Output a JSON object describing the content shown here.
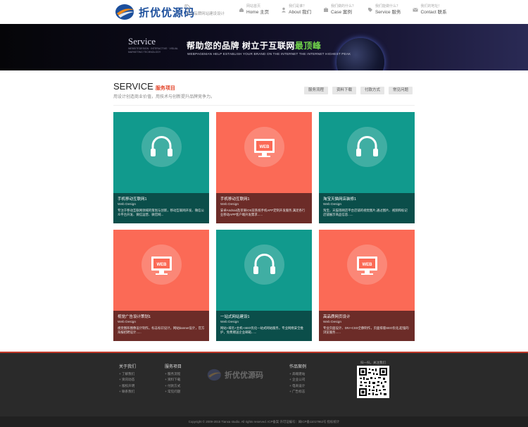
{
  "header": {
    "logo_text": "折优优源码",
    "tagline": "专注品牌网站建设设计",
    "nav": [
      {
        "sub": "网站首页",
        "label": "Home 主页",
        "icon": "home-icon"
      },
      {
        "sub": "我们是谁？",
        "label": "About 我们",
        "icon": "user-icon"
      },
      {
        "sub": "我们做的什么？",
        "label": "Case 案例",
        "icon": "case-icon"
      },
      {
        "sub": "我们能做什么？",
        "label": "Service 服务",
        "icon": "service-icon"
      },
      {
        "sub": "我们的地址！",
        "label": "Contact 联系",
        "icon": "mail-icon"
      }
    ]
  },
  "banner": {
    "service_word": "Service",
    "service_small": "WEBSITEDESIGN · INTERACTIVE · VISUAL MARKETING TECHNOLOGY",
    "headline_main": "帮助您的品牌  树立于互联网",
    "headline_accent": "最顶峰",
    "subline": "WEBPAGEMAN HELP ESTABLISH YOUR BRAND ON THE INTERNET THE INTERNET HIGHEST PEAK"
  },
  "section": {
    "title_en": "SERVICE",
    "title_cn": "服务项目",
    "description": "用设计创造商业价值，用技术与创新提升品牌竞争力。",
    "tabs": [
      "服务流程",
      "资料下载",
      "付款方式",
      "常见问题"
    ]
  },
  "cards": [
    {
      "theme": "teal",
      "icon": "headphones-icon",
      "title": "手机移动互联网1",
      "en": "Web Design",
      "desc": "专注于移动互联网领域的策划与创新，移动互联网开发、微信公众平台开发、微信运营、微官网..."
    },
    {
      "theme": "coral",
      "icon": "web-monitor-icon",
      "icon_label": "WEB",
      "title": "手机移动互联网1",
      "en": "Web Design",
      "desc": "安卓Android及苹果iOS双系统手机APP定制开发服务,满足各行业移动APP客户端开发需求......"
    },
    {
      "theme": "teal",
      "icon": "headphones-icon",
      "title": "淘宝天猫网店装修1",
      "en": "Web Design",
      "desc": "淘宝、天猫等网店平台店铺的视觉图片,通过图片、视频和标记店铺展示商品信息......"
    },
    {
      "theme": "coral",
      "icon": "web-monitor-icon",
      "icon_label": "WEB",
      "title": "视觉广告设计策划1",
      "en": "Web Design",
      "desc": "视觉图形图像设计制作，标志标识设计，网站banner设计，官方海报招聘设计......"
    },
    {
      "theme": "teal",
      "icon": "headphones-icon",
      "title": "一站式网站建设1",
      "en": "Web Design",
      "desc": "网站+域名+主机+SEO优化一站式网站服务，专业网络安全维护，免费赠送企业邮箱......"
    },
    {
      "theme": "coral",
      "icon": "web-monitor-icon",
      "icon_label": "WEB",
      "title": "高品质网页设计",
      "en": "Web Design",
      "desc": "专业页面设计、DIV+CSS全静制作，页面排版SEO优化,超强的浏览服务......"
    }
  ],
  "footer": {
    "columns": [
      {
        "title": "关于我们",
        "links": [
          "+ 了解我们",
          "+ 资讯动态",
          "+ 版权声明",
          "+ 联系我们"
        ]
      },
      {
        "title": "服务项目",
        "links": [
          "+ 服务流程",
          "+ 资料下载",
          "+ 付款方式",
          "+ 常见问题"
        ]
      },
      {
        "title": "作品案例",
        "links": [
          "+ 高端建站",
          "+ 企业公司",
          "+ 电商设计",
          "+ 广告标志"
        ]
      }
    ],
    "logo_text": "折优优源码",
    "qr_caption": "扫一扫，关注我们",
    "copyright": "Copyright © 2009-2015 Tianxa studio. All rights reserved. ICP备案 许可证编号：闽ICP备11017962号  指标统计"
  },
  "colors": {
    "teal": "#119a8d",
    "teal_dark": "#0b4e4a",
    "coral": "#fb6a56",
    "coral_dark": "#6c2c28",
    "accent_red": "#e3452a",
    "banner_green": "#6fd24a"
  }
}
